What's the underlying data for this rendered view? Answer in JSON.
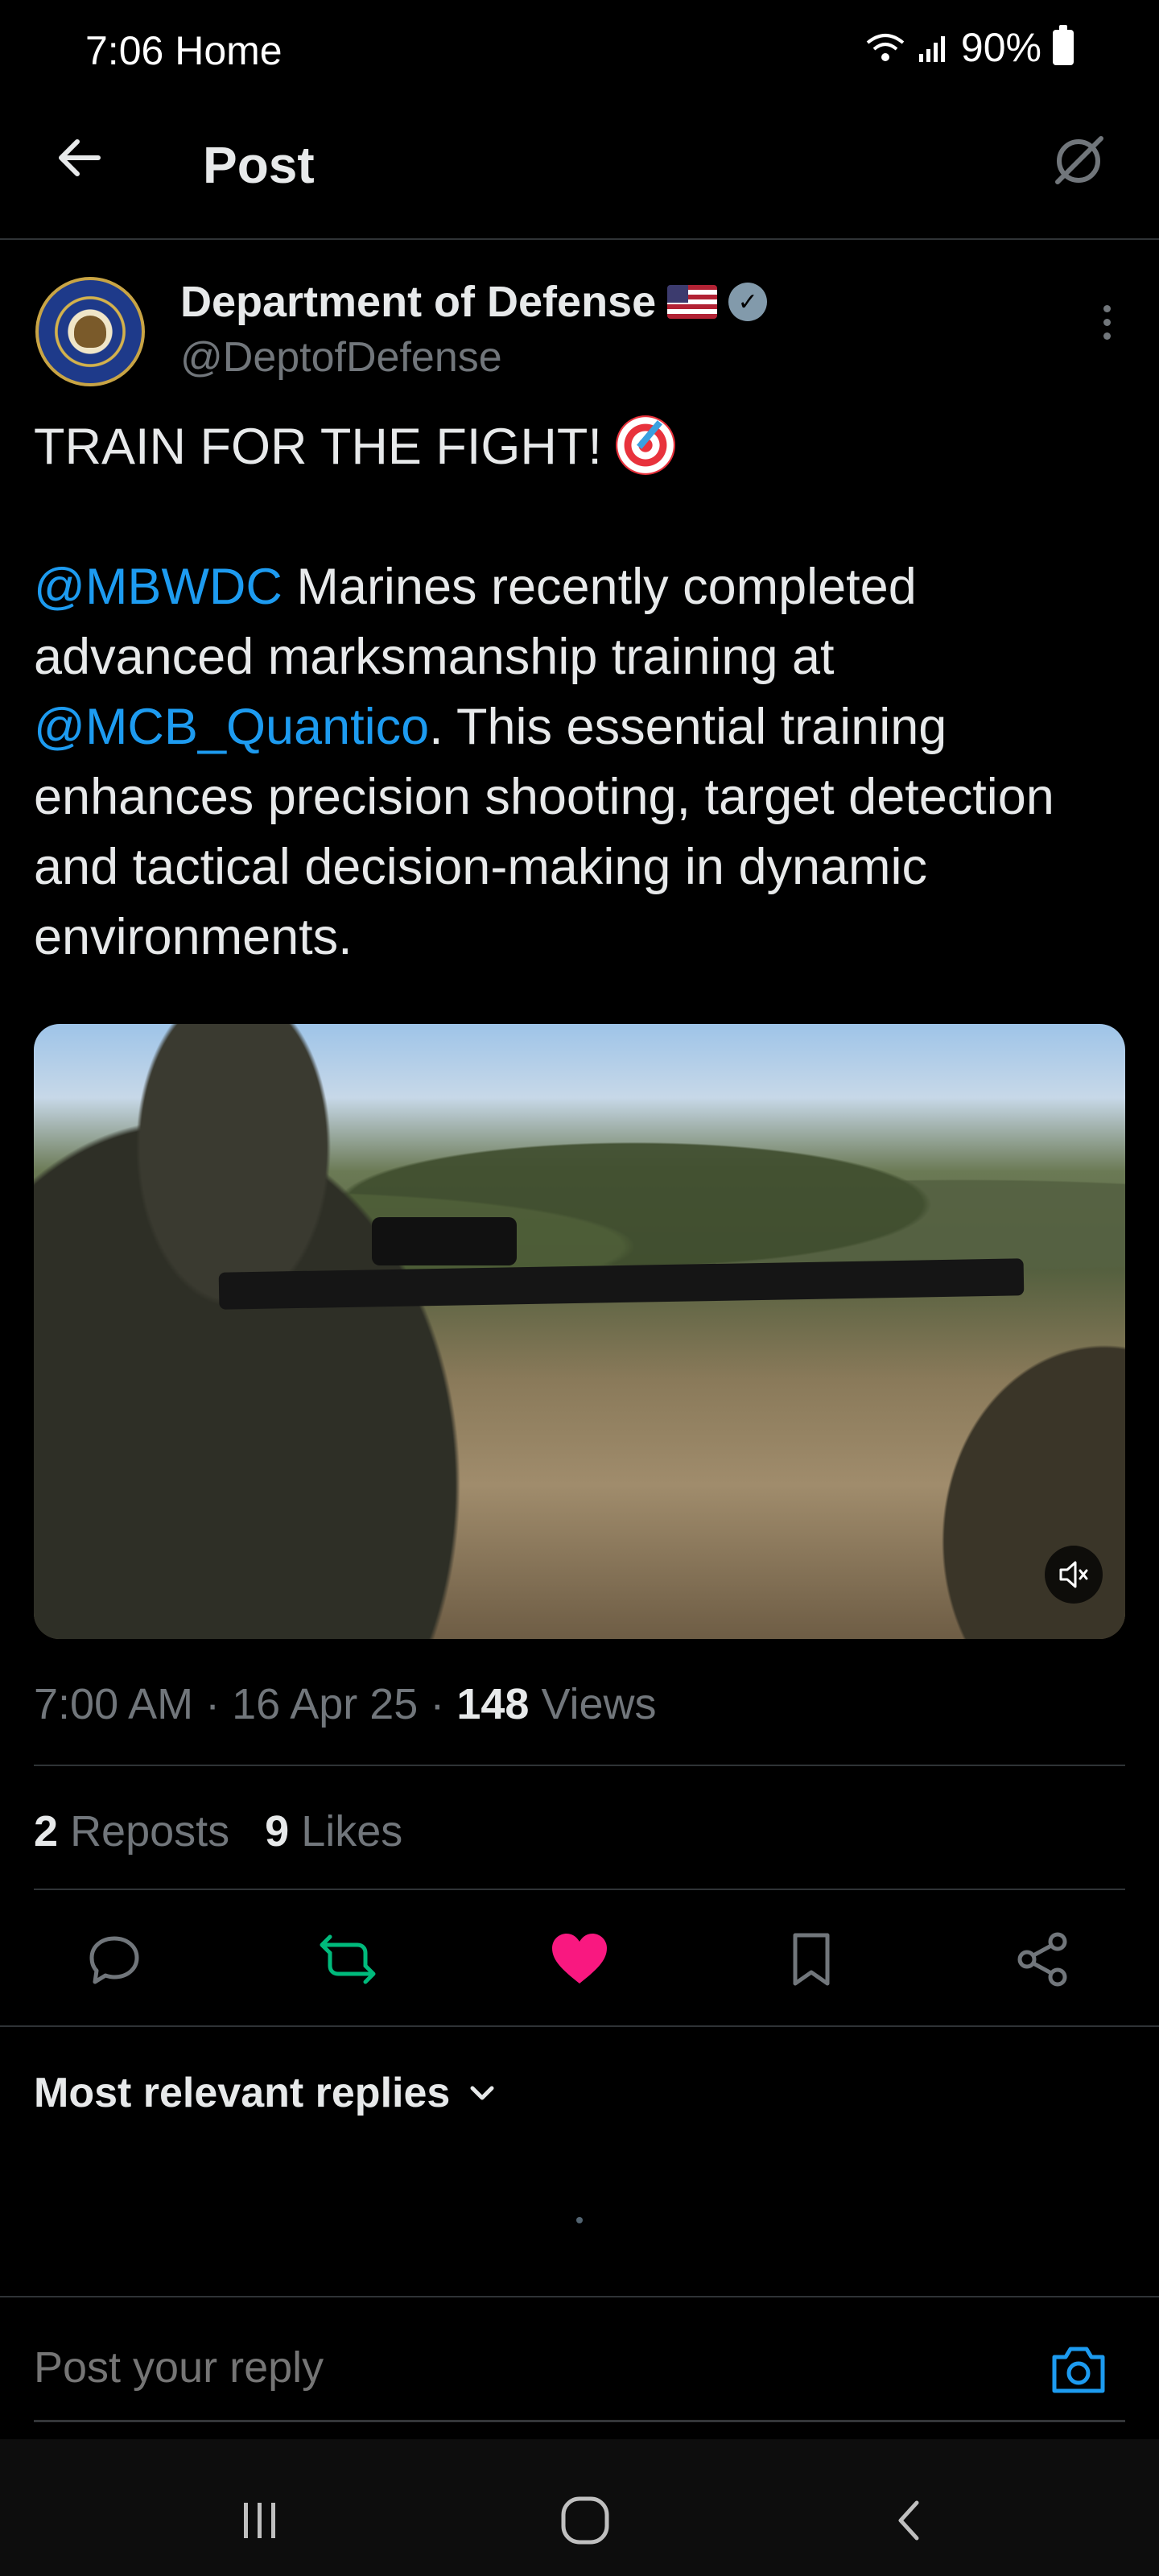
{
  "status_bar": {
    "time_home": "7:06 Home",
    "battery": "90%"
  },
  "header": {
    "title": "Post"
  },
  "post": {
    "author_name": "Department of Defense",
    "author_handle": "@DeptofDefense",
    "text_line1": "TRAIN FOR THE FIGHT!",
    "mention1": "@MBWDC",
    "text_part2": " Marines recently completed advanced marksmanship training at ",
    "mention2": "@MCB_Quantico",
    "text_part3": ". This essential training enhances precision shooting, target detection and tactical decision-making in dynamic environments.",
    "time": "7:00 AM",
    "date": "16 Apr 25",
    "views_count": "148",
    "views_label": "Views",
    "reposts_count": "2",
    "reposts_label": "Reposts",
    "likes_count": "9",
    "likes_label": "Likes"
  },
  "replies": {
    "sort_label": "Most relevant replies"
  },
  "reply_box": {
    "placeholder": "Post your reply"
  },
  "icons": {
    "back": "arrow-left-icon",
    "grok": "grok-icon",
    "verified": "verified-badge-icon",
    "more": "more-vertical-icon",
    "mute": "volume-mute-icon",
    "reply": "reply-icon",
    "repost": "repost-icon",
    "like": "heart-icon",
    "bookmark": "bookmark-icon",
    "share": "share-icon",
    "camera": "camera-icon"
  },
  "colors": {
    "background": "#000000",
    "text": "#e7e9ea",
    "secondary_text": "#71767b",
    "link": "#1d9bf0",
    "repost_active": "#00ba7c",
    "like_active": "#f91880",
    "divider": "#2f3336"
  }
}
